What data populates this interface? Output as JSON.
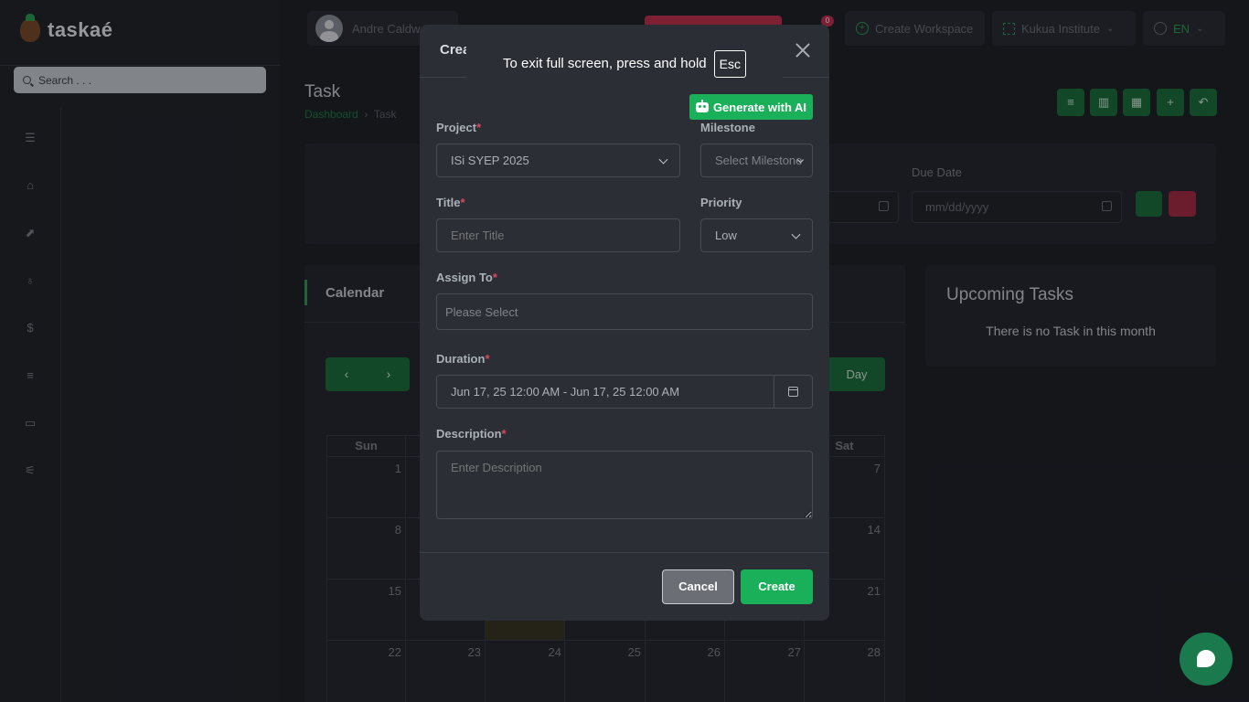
{
  "app": {
    "brand": "taskaé"
  },
  "sidebar": {
    "search_placeholder": "Search . . ."
  },
  "rail_icons": [
    "menu-collapse-icon",
    "home-icon",
    "chart-icon",
    "users-icon",
    "money-icon",
    "list-icon",
    "chat-icon",
    "settings-sliders-icon"
  ],
  "topbar": {
    "user_name": "Andre Caldw",
    "notifications_count": "0",
    "create_workspace": "Create Workspace",
    "workspace": "Kukua Institute",
    "language": "EN"
  },
  "page": {
    "title": "Task",
    "breadcrumb": [
      "Dashboard",
      "Task"
    ]
  },
  "filters": {
    "due_date_label": "Due Date",
    "date_placeholder": "mm/dd/yyyy"
  },
  "calendar": {
    "title": "Calendar",
    "prev": "‹",
    "next": "›",
    "view_day": "Day",
    "weekdays": [
      "Sun",
      "Sat"
    ],
    "days": [
      "1",
      "7",
      "8",
      "14",
      "15",
      "21",
      "22",
      "23",
      "24",
      "25",
      "26",
      "27",
      "28"
    ]
  },
  "upcoming": {
    "title": "Upcoming Tasks",
    "empty": "There is no Task in this month"
  },
  "modal": {
    "title": "Crea",
    "ai_button": "Generate with AI",
    "project": {
      "label": "Project",
      "value": "ISi SYEP 2025"
    },
    "milestone": {
      "label": "Milestone",
      "placeholder": "Select Milestone"
    },
    "title_field": {
      "label": "Title",
      "placeholder": "Enter Title"
    },
    "priority": {
      "label": "Priority",
      "value": "Low"
    },
    "assign_to": {
      "label": "Assign To",
      "placeholder": "Please Select"
    },
    "duration": {
      "label": "Duration",
      "value": "Jun 17, 25 12:00 AM - Jun 17, 25 12:00 AM"
    },
    "description": {
      "label": "Description",
      "placeholder": "Enter Description"
    },
    "required_mark": "*",
    "cancel": "Cancel",
    "create": "Create"
  },
  "fullscreen_notice": {
    "text": "To exit full screen, press and hold",
    "key": "Esc"
  },
  "colors": {
    "accent_green": "#1ab05a",
    "danger_red": "#c2324f",
    "surface": "#2b2e35"
  }
}
